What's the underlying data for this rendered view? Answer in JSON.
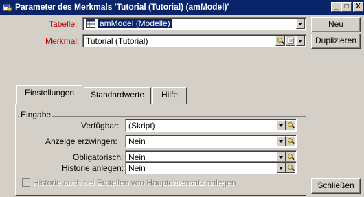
{
  "window": {
    "title": "Parameter des Merkmals 'Tutorial (Tutorial) (amModel)'",
    "minimize_label": "_",
    "maximize_label": "□",
    "close_label": "X"
  },
  "form": {
    "tabelle_label": "Tabelle:",
    "tabelle_value": "amModel (Modelle)",
    "merkmal_label": "Merkmal:",
    "merkmal_value": "Tutorial (Tutorial)"
  },
  "buttons": {
    "neu": "Neu",
    "duplizieren": "Duplizieren",
    "schliessen": "Schließen"
  },
  "tabs": [
    {
      "label": "Einstellungen",
      "active": true
    },
    {
      "label": "Standardwerte",
      "active": false
    },
    {
      "label": "Hilfe",
      "active": false
    }
  ],
  "group": {
    "title": "Eingabe"
  },
  "fields": {
    "verfuegbar_label": "Verfügbar:",
    "verfuegbar_value": "(Skript)",
    "anzeige_label": "Anzeige erzwingen:",
    "anzeige_value": "Nein",
    "obligatorisch_label": "Obligatorisch:",
    "obligatorisch_value": "Nein",
    "historie_label": "Historie anlegen:",
    "historie_value": "Nein"
  },
  "checkbox": {
    "label": "Historie auch bei Erstellen von Hauptdatensatz anlegen",
    "checked": false,
    "enabled": false
  },
  "colors": {
    "titlebar": "#0a246a",
    "label_red": "#c00000",
    "face": "#d4d0c8"
  }
}
